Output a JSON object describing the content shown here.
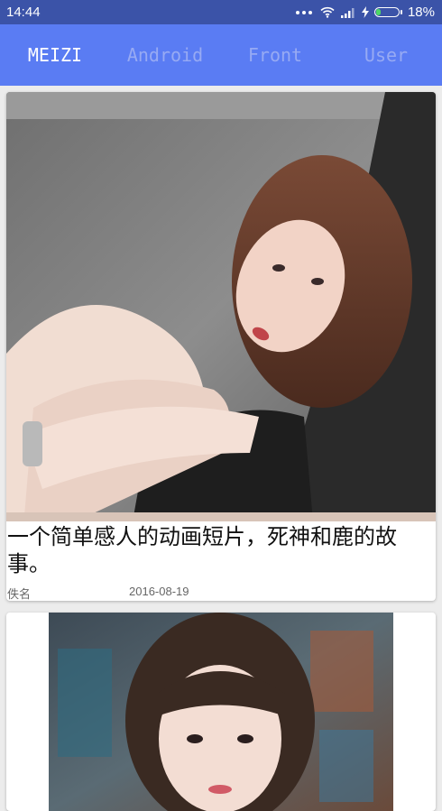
{
  "status_bar": {
    "time": "14:44",
    "battery": "18%"
  },
  "tabs": [
    {
      "label": "MEIZI",
      "active": true
    },
    {
      "label": "Android",
      "active": false
    },
    {
      "label": "Front",
      "active": false
    },
    {
      "label": "User",
      "active": false
    }
  ],
  "colors": {
    "status_bar": "#3b53a8",
    "tab_bar": "#5a7cf3",
    "tab_active": "#ffffff",
    "tab_inactive": "#97aaf3"
  },
  "feed": [
    {
      "title": "一个简单感人的动画短片，死神和鹿的故事。",
      "author": "佚名",
      "date": "2016-08-19"
    },
    {}
  ]
}
